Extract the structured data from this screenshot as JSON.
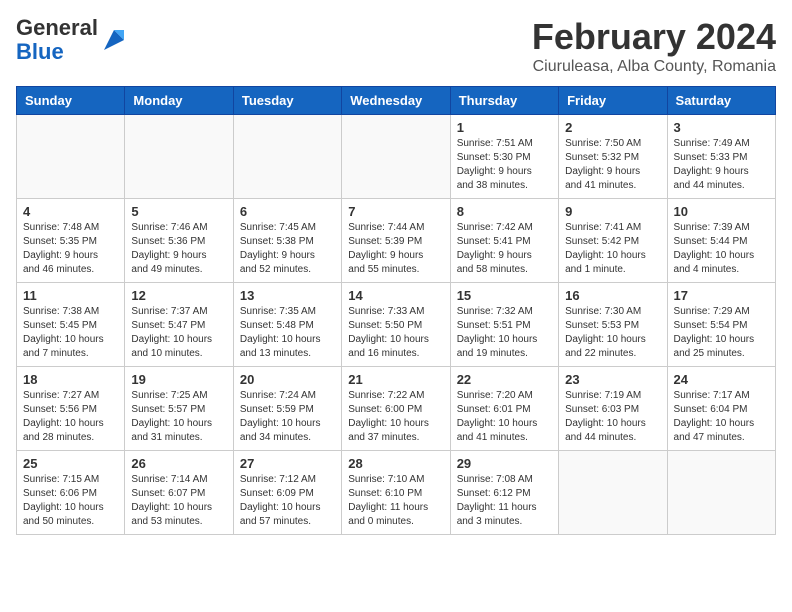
{
  "header": {
    "logo_general": "General",
    "logo_blue": "Blue",
    "title": "February 2024",
    "location": "Ciuruleasa, Alba County, Romania"
  },
  "weekdays": [
    "Sunday",
    "Monday",
    "Tuesday",
    "Wednesday",
    "Thursday",
    "Friday",
    "Saturday"
  ],
  "weeks": [
    [
      {
        "day": "",
        "info": ""
      },
      {
        "day": "",
        "info": ""
      },
      {
        "day": "",
        "info": ""
      },
      {
        "day": "",
        "info": ""
      },
      {
        "day": "1",
        "info": "Sunrise: 7:51 AM\nSunset: 5:30 PM\nDaylight: 9 hours\nand 38 minutes."
      },
      {
        "day": "2",
        "info": "Sunrise: 7:50 AM\nSunset: 5:32 PM\nDaylight: 9 hours\nand 41 minutes."
      },
      {
        "day": "3",
        "info": "Sunrise: 7:49 AM\nSunset: 5:33 PM\nDaylight: 9 hours\nand 44 minutes."
      }
    ],
    [
      {
        "day": "4",
        "info": "Sunrise: 7:48 AM\nSunset: 5:35 PM\nDaylight: 9 hours\nand 46 minutes."
      },
      {
        "day": "5",
        "info": "Sunrise: 7:46 AM\nSunset: 5:36 PM\nDaylight: 9 hours\nand 49 minutes."
      },
      {
        "day": "6",
        "info": "Sunrise: 7:45 AM\nSunset: 5:38 PM\nDaylight: 9 hours\nand 52 minutes."
      },
      {
        "day": "7",
        "info": "Sunrise: 7:44 AM\nSunset: 5:39 PM\nDaylight: 9 hours\nand 55 minutes."
      },
      {
        "day": "8",
        "info": "Sunrise: 7:42 AM\nSunset: 5:41 PM\nDaylight: 9 hours\nand 58 minutes."
      },
      {
        "day": "9",
        "info": "Sunrise: 7:41 AM\nSunset: 5:42 PM\nDaylight: 10 hours\nand 1 minute."
      },
      {
        "day": "10",
        "info": "Sunrise: 7:39 AM\nSunset: 5:44 PM\nDaylight: 10 hours\nand 4 minutes."
      }
    ],
    [
      {
        "day": "11",
        "info": "Sunrise: 7:38 AM\nSunset: 5:45 PM\nDaylight: 10 hours\nand 7 minutes."
      },
      {
        "day": "12",
        "info": "Sunrise: 7:37 AM\nSunset: 5:47 PM\nDaylight: 10 hours\nand 10 minutes."
      },
      {
        "day": "13",
        "info": "Sunrise: 7:35 AM\nSunset: 5:48 PM\nDaylight: 10 hours\nand 13 minutes."
      },
      {
        "day": "14",
        "info": "Sunrise: 7:33 AM\nSunset: 5:50 PM\nDaylight: 10 hours\nand 16 minutes."
      },
      {
        "day": "15",
        "info": "Sunrise: 7:32 AM\nSunset: 5:51 PM\nDaylight: 10 hours\nand 19 minutes."
      },
      {
        "day": "16",
        "info": "Sunrise: 7:30 AM\nSunset: 5:53 PM\nDaylight: 10 hours\nand 22 minutes."
      },
      {
        "day": "17",
        "info": "Sunrise: 7:29 AM\nSunset: 5:54 PM\nDaylight: 10 hours\nand 25 minutes."
      }
    ],
    [
      {
        "day": "18",
        "info": "Sunrise: 7:27 AM\nSunset: 5:56 PM\nDaylight: 10 hours\nand 28 minutes."
      },
      {
        "day": "19",
        "info": "Sunrise: 7:25 AM\nSunset: 5:57 PM\nDaylight: 10 hours\nand 31 minutes."
      },
      {
        "day": "20",
        "info": "Sunrise: 7:24 AM\nSunset: 5:59 PM\nDaylight: 10 hours\nand 34 minutes."
      },
      {
        "day": "21",
        "info": "Sunrise: 7:22 AM\nSunset: 6:00 PM\nDaylight: 10 hours\nand 37 minutes."
      },
      {
        "day": "22",
        "info": "Sunrise: 7:20 AM\nSunset: 6:01 PM\nDaylight: 10 hours\nand 41 minutes."
      },
      {
        "day": "23",
        "info": "Sunrise: 7:19 AM\nSunset: 6:03 PM\nDaylight: 10 hours\nand 44 minutes."
      },
      {
        "day": "24",
        "info": "Sunrise: 7:17 AM\nSunset: 6:04 PM\nDaylight: 10 hours\nand 47 minutes."
      }
    ],
    [
      {
        "day": "25",
        "info": "Sunrise: 7:15 AM\nSunset: 6:06 PM\nDaylight: 10 hours\nand 50 minutes."
      },
      {
        "day": "26",
        "info": "Sunrise: 7:14 AM\nSunset: 6:07 PM\nDaylight: 10 hours\nand 53 minutes."
      },
      {
        "day": "27",
        "info": "Sunrise: 7:12 AM\nSunset: 6:09 PM\nDaylight: 10 hours\nand 57 minutes."
      },
      {
        "day": "28",
        "info": "Sunrise: 7:10 AM\nSunset: 6:10 PM\nDaylight: 11 hours\nand 0 minutes."
      },
      {
        "day": "29",
        "info": "Sunrise: 7:08 AM\nSunset: 6:12 PM\nDaylight: 11 hours\nand 3 minutes."
      },
      {
        "day": "",
        "info": ""
      },
      {
        "day": "",
        "info": ""
      }
    ]
  ]
}
